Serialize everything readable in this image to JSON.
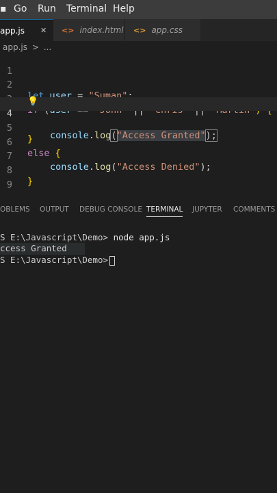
{
  "menubar": {
    "items": [
      {
        "label": "Go"
      },
      {
        "label": "Run"
      },
      {
        "label": "Terminal"
      },
      {
        "label": "Help"
      }
    ]
  },
  "tabs": [
    {
      "label": "app.js",
      "icon": "js-file-icon",
      "active": true
    },
    {
      "label": "index.html",
      "icon": "html-file-icon",
      "active": false
    },
    {
      "label": "app.css",
      "icon": "css-file-icon",
      "active": false
    }
  ],
  "tab_close_glyph": "✕",
  "tab_icon_glyph": "<>",
  "breadcrumb": {
    "file": "app.js",
    "separator": ">",
    "rest": "..."
  },
  "editor": {
    "line_numbers": [
      "1",
      "2",
      "3",
      "4",
      "5",
      "6",
      "7",
      "8",
      "9"
    ],
    "current_line": 4,
    "code": {
      "l2_kw": "let",
      "l2_var": "user",
      "l2_op": " = ",
      "l2_str": "\"Suman\"",
      "l2_end": ";",
      "l3_kw": "if",
      "l3_open": " (",
      "l3_var": "user",
      "l3_eq": " == ",
      "l3_s1": "'John'",
      "l3_or1": " || ",
      "l3_s2": "'Chris'",
      "l3_or2": " || ",
      "l3_s3": "'Martin'",
      "l3_close": ") {",
      "l4_obj": "console",
      "l4_dot": ".",
      "l4_fn": "log",
      "l4_open": "(",
      "l4_str": "\"Access Granted\"",
      "l4_close": ");",
      "l5": "}",
      "l6_kw": "else",
      "l6_brace": " {",
      "l7_obj": "console",
      "l7_dot": ".",
      "l7_fn": "log",
      "l7_open": "(",
      "l7_str": "\"Access Denied\"",
      "l7_close": ");",
      "l8": "}"
    }
  },
  "panel": {
    "tabs": [
      {
        "label": "OBLEMS",
        "active": false
      },
      {
        "label": "OUTPUT",
        "active": false
      },
      {
        "label": "DEBUG CONSOLE",
        "active": false
      },
      {
        "label": "TERMINAL",
        "active": true
      },
      {
        "label": "JUPYTER",
        "active": false
      },
      {
        "label": "COMMENTS",
        "active": false
      }
    ]
  },
  "terminal": {
    "line1_prompt": "S E:\\Javascript\\Demo>",
    "line1_cmd": " node app.js",
    "line2_output": "ccess Granted",
    "line3_prompt": "S E:\\Javascript\\Demo>"
  },
  "colors": {
    "editor_bg": "#1e1e1e",
    "keyword": "#569cd6",
    "control_keyword": "#c586c0",
    "string": "#ce9178",
    "function": "#dcdcaa",
    "variable": "#9cdcfe",
    "js_icon": "#e8c547",
    "html_icon": "#e37933",
    "css_icon": "#e8a33b"
  }
}
